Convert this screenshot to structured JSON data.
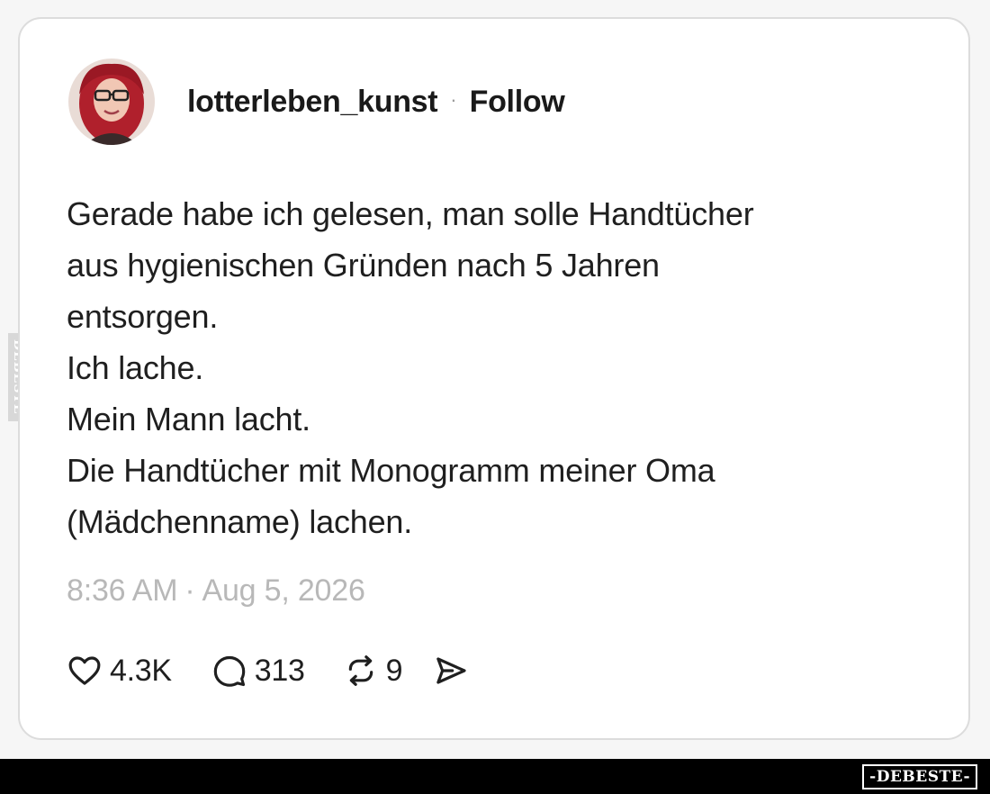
{
  "post": {
    "username": "lotterleben_kunst",
    "separator": "·",
    "follow_label": "Follow",
    "text_lines": [
      "Gerade habe ich gelesen, man solle Handtücher",
      "aus hygienischen Gründen nach 5 Jahren",
      "entsorgen.",
      "Ich lache.",
      "Mein Mann lacht.",
      "Die Handtücher mit Monogramm meiner Oma",
      "(Mädchenname) lachen."
    ],
    "time": "8:36 AM",
    "date_separator": "·",
    "date": "Aug 5, 2026"
  },
  "actions": {
    "likes": "4.3K",
    "comments": "313",
    "reposts": "9",
    "icons": [
      "heart-icon",
      "comment-icon",
      "repost-icon",
      "share-icon"
    ]
  },
  "watermark": {
    "side_text": "DEBESTE",
    "badge_text": "-DEBESTE-"
  },
  "colors": {
    "text": "#1f1f1f",
    "timestamp": "#b8b8b8",
    "card_border": "#dcdcdc",
    "avatar_hair": "#b0202c",
    "footer": "#000000"
  }
}
